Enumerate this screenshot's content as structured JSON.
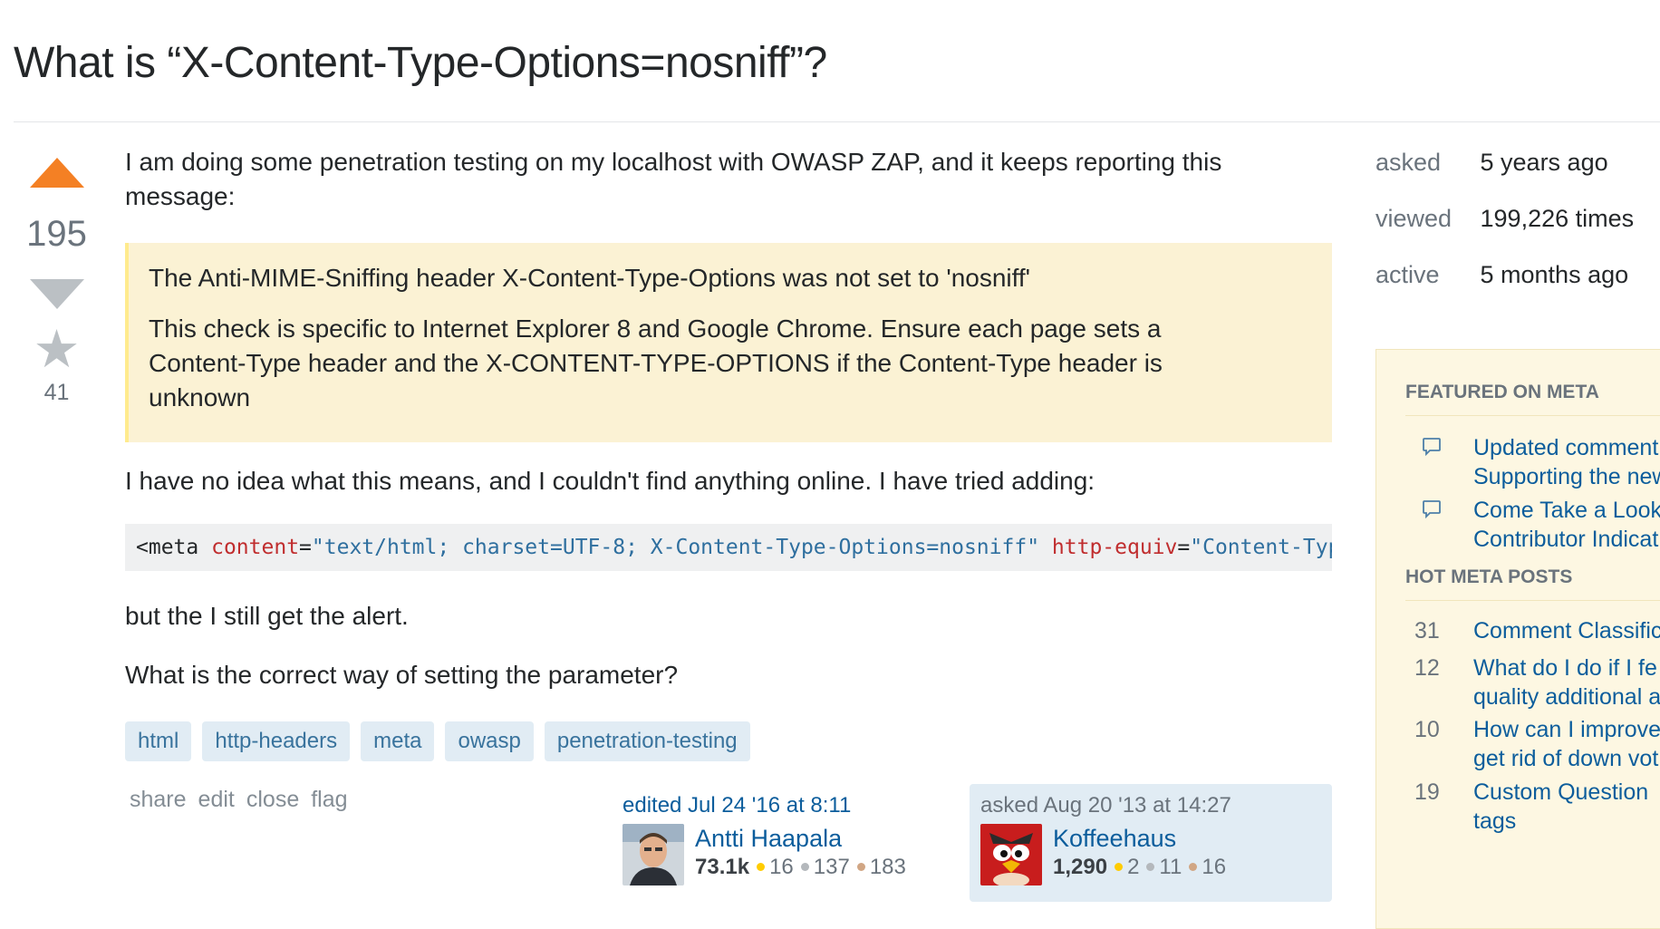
{
  "question": {
    "title": "What is “X-Content-Type-Options=nosniff”?",
    "score": "195",
    "favorites": "41",
    "intro_line1": "I am doing some penetration testing on my localhost with OWASP ZAP, and it keeps reporting this",
    "intro_line2": "message:",
    "quote_line1": "The Anti-MIME-Sniffing header X-Content-Type-Options was not set to 'nosniff'",
    "quote_line2": "This check is specific to Internet Explorer 8 and Google Chrome. Ensure each page sets a",
    "quote_line3": "Content-Type header and the X-CONTENT-TYPE-OPTIONS if the Content-Type header is",
    "quote_line4": "unknown",
    "para2": "I have no idea what this means, and I couldn't find anything online. I have tried adding:",
    "code": {
      "open": "<meta",
      "attr1": "content",
      "eq1": "=",
      "val1": "\"text/html; charset=UTF-8; X-Content-Type-Options=nosniff\"",
      "attr2": "http-equiv",
      "eq2": "=",
      "val2": "\"Content-Type\">"
    },
    "para3": "but the I still get the alert.",
    "para4": "What is the correct way of setting the parameter?",
    "tags": [
      "html",
      "http-headers",
      "meta",
      "owasp",
      "penetration-testing"
    ],
    "menu": [
      "share",
      "edit",
      "close",
      "flag"
    ],
    "editor": {
      "action": "edited Jul 24 '16 at 8:11",
      "name": "Antti Haapala",
      "rep": "73.1k",
      "gold": "16",
      "silver": "137",
      "bronze": "183"
    },
    "owner": {
      "action": "asked Aug 20 '13 at 14:27",
      "name": "Koffeehaus",
      "rep": "1,290",
      "gold": "2",
      "silver": "11",
      "bronze": "16"
    }
  },
  "sidebar": {
    "stats": [
      {
        "label": "asked",
        "value": "5 years ago"
      },
      {
        "label": "viewed",
        "value": "199,226 times"
      },
      {
        "label": "active",
        "value": "5 months ago"
      }
    ],
    "featured_heading": "FEATURED ON META",
    "featured": [
      {
        "line1": "Updated comment",
        "line2": "Supporting the new"
      },
      {
        "line1": "Come Take a Look",
        "line2": "Contributor Indicat"
      }
    ],
    "hot_heading": "HOT META POSTS",
    "hot": [
      {
        "count": "31",
        "line1": "Comment Classific",
        "line2": ""
      },
      {
        "count": "12",
        "line1": "What do I do if I fe",
        "line2": "quality additional a"
      },
      {
        "count": "10",
        "line1": "How can I improve",
        "line2": "get rid of down vot"
      },
      {
        "count": "19",
        "line1": "Custom Question",
        "line2": "tags"
      }
    ]
  },
  "colors": {
    "upvote": "#f48024",
    "link": "#0c5d9c",
    "tag_bg": "#e1ecf4",
    "quote_bg": "#fbf2d4",
    "meta_bg": "#fdf7e2"
  }
}
